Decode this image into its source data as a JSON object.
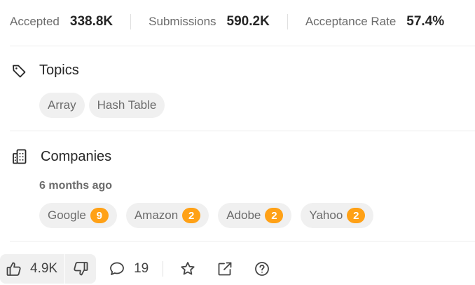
{
  "stats": {
    "accepted_label": "Accepted",
    "accepted_value": "338.8K",
    "submissions_label": "Submissions",
    "submissions_value": "590.2K",
    "rate_label": "Acceptance Rate",
    "rate_value": "57.4%"
  },
  "topics": {
    "title": "Topics",
    "icon": "tag-icon",
    "tags": [
      "Array",
      "Hash Table"
    ]
  },
  "companies": {
    "title": "Companies",
    "icon": "building-icon",
    "time_label": "6 months ago",
    "items": [
      {
        "name": "Google",
        "count": "9"
      },
      {
        "name": "Amazon",
        "count": "2"
      },
      {
        "name": "Adobe",
        "count": "2"
      },
      {
        "name": "Yahoo",
        "count": "2"
      }
    ]
  },
  "footer": {
    "likes": "4.9K",
    "comments": "19",
    "icons": [
      "thumbs-up-icon",
      "thumbs-down-icon",
      "comment-icon",
      "star-icon",
      "share-icon",
      "help-icon"
    ]
  },
  "colors": {
    "accent": "#ffa116",
    "chip_bg": "#f0f0f0",
    "muted_text": "#6b6b6b"
  }
}
